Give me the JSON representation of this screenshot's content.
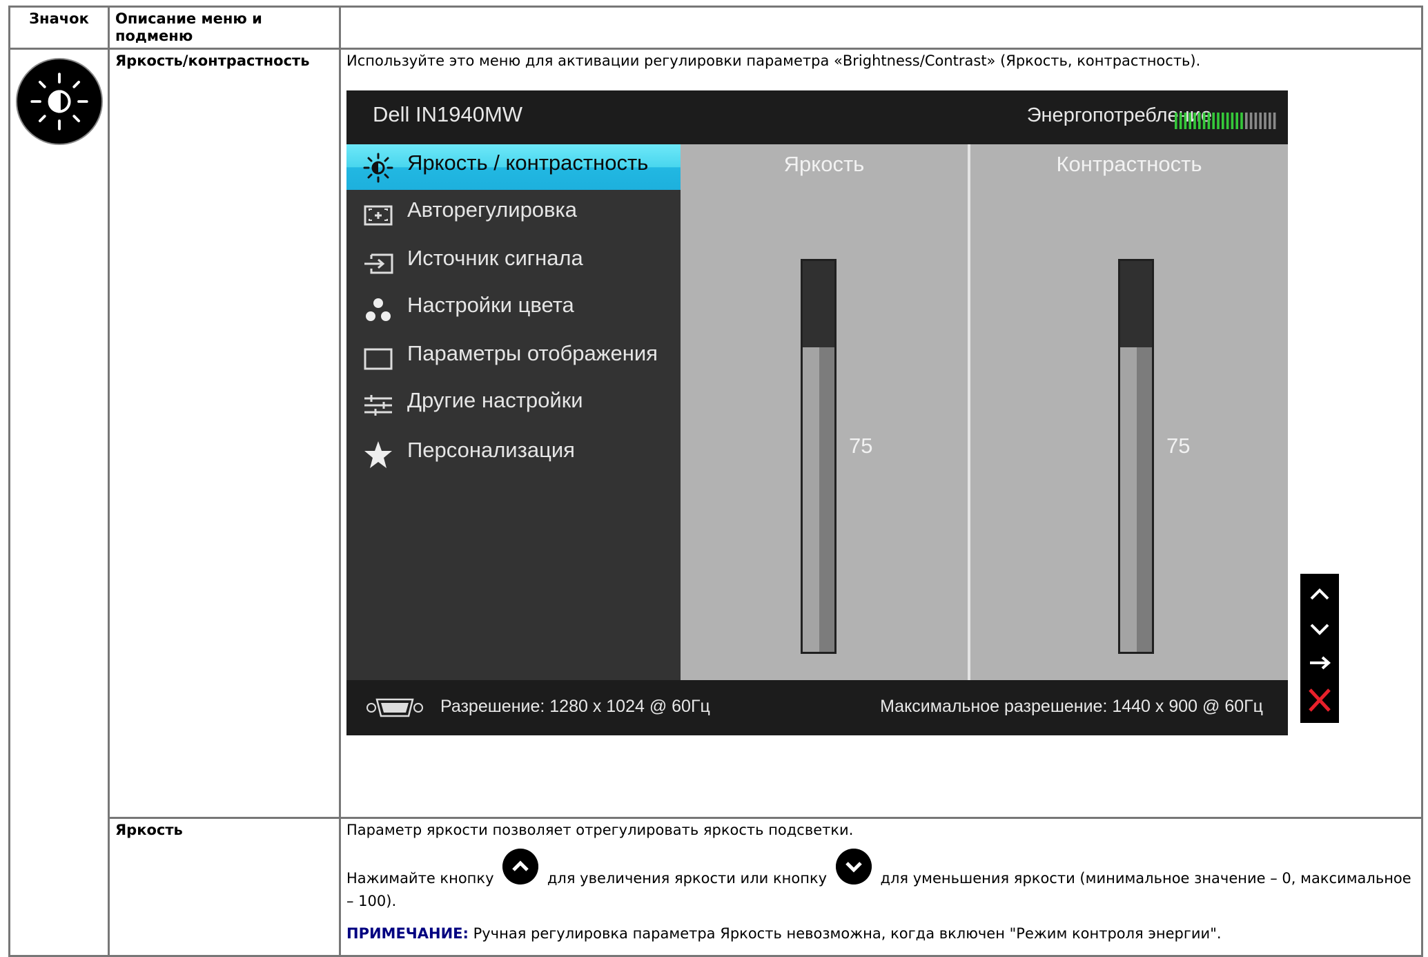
{
  "table": {
    "headers": {
      "icon": "Значок",
      "description": "Описание меню и подменю"
    },
    "rows": [
      {
        "name": "Яркость/контрастность",
        "icon": "brightness-contrast-icon",
        "description": "Используйте это меню для активации регулировки параметра «Brightness/Contrast» (Яркость, контрастность)."
      },
      {
        "name": "Яркость",
        "description": "Параметр яркости позволяет отрегулировать яркость подсветки.",
        "instruction_before": "Нажимайте кнопку",
        "instruction_middle": "для увеличения яркости или кнопку",
        "instruction_after": "для уменьшения яркости (минимальное значение – 0, максимальное – 100).",
        "note_label": "ПРИМЕЧАНИЕ:",
        "note_text": "Ручная регулировка параметра Яркость невозможна, когда включен \"Режим контроля энергии\"."
      }
    ]
  },
  "osd": {
    "model": "Dell IN1940MW",
    "energy_label": "Энергопотребление",
    "energy_level_fraction": 0.7,
    "menu": [
      {
        "label": "Яркость / контрастность",
        "icon": "brightness-icon",
        "active": true
      },
      {
        "label": "Авторегулировка",
        "icon": "auto-adjust-icon",
        "active": false
      },
      {
        "label": "Источник сигнала",
        "icon": "input-source-icon",
        "active": false
      },
      {
        "label": "Настройки цвета",
        "icon": "color-settings-icon",
        "active": false
      },
      {
        "label": "Параметры отображения",
        "icon": "display-settings-icon",
        "active": false
      },
      {
        "label": "Другие настройки",
        "icon": "other-settings-icon",
        "active": false
      },
      {
        "label": "Персонализация",
        "icon": "star-icon",
        "active": false
      }
    ],
    "brightness": {
      "title": "Яркость",
      "value": "75",
      "level": 75
    },
    "contrast": {
      "title": "Контрастность",
      "value": "75",
      "level": 75
    },
    "footer": {
      "resolution": "Разрешение: 1280 x 1024 @ 60Гц",
      "max_resolution": "Максимальное разрешение: 1440 x 900 @ 60Гц"
    },
    "nav_buttons": [
      "up-arrow-icon",
      "down-arrow-icon",
      "right-arrow-icon",
      "close-icon"
    ],
    "colors": {
      "active_menu": "#3fcfee",
      "close": "#e8202a",
      "energy_on": "#35c83a"
    }
  }
}
